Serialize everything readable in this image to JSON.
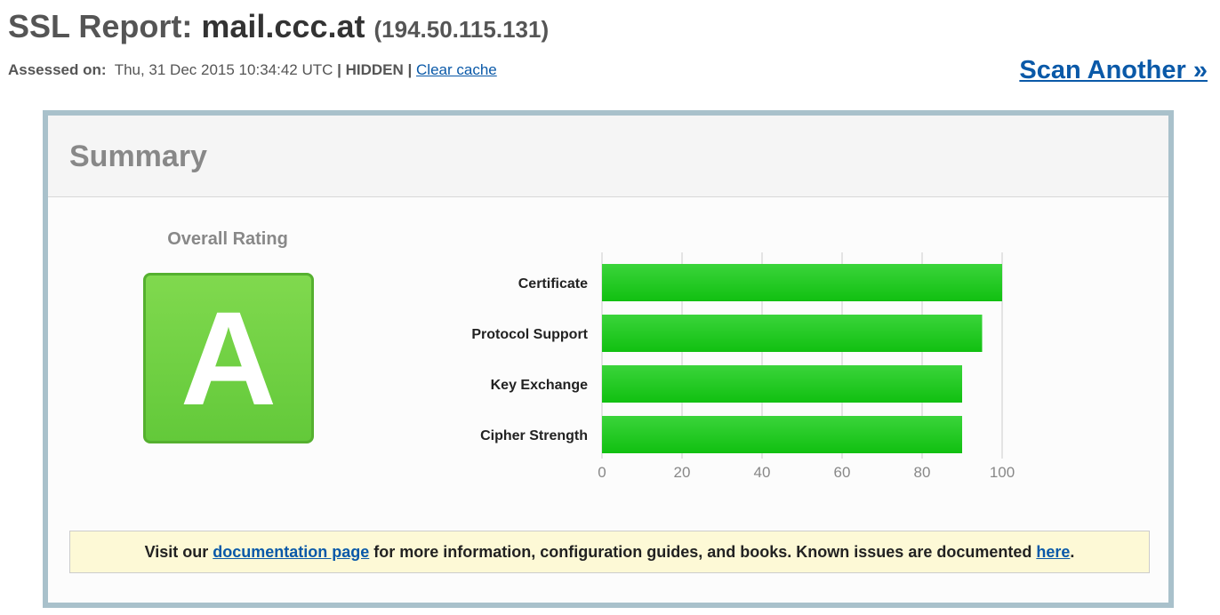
{
  "header": {
    "title_prefix": "SSL Report: ",
    "host": "mail.ccc.at",
    "ip": "(194.50.115.131)",
    "assessed_label": "Assessed on:",
    "assessed_date": "Thu, 31 Dec 2015 10:34:42 UTC",
    "separator": "|",
    "visibility": "HIDDEN",
    "clear_cache": "Clear cache",
    "scan_another": "Scan Another »"
  },
  "summary": {
    "title": "Summary",
    "rating_label": "Overall Rating",
    "grade": "A",
    "grade_color": "#6fd044"
  },
  "chart_data": {
    "type": "bar",
    "orientation": "horizontal",
    "categories": [
      "Certificate",
      "Protocol Support",
      "Key Exchange",
      "Cipher Strength"
    ],
    "values": [
      100,
      95,
      90,
      90
    ],
    "xlim": [
      0,
      100
    ],
    "ticks": [
      0,
      20,
      40,
      60,
      80,
      100
    ],
    "grid": true,
    "bar_color": "#11c011"
  },
  "note": {
    "text_1": "Visit our ",
    "link_1": "documentation page",
    "text_2": " for more information, configuration guides, and books. Known issues are documented ",
    "link_2": "here",
    "text_3": "."
  }
}
